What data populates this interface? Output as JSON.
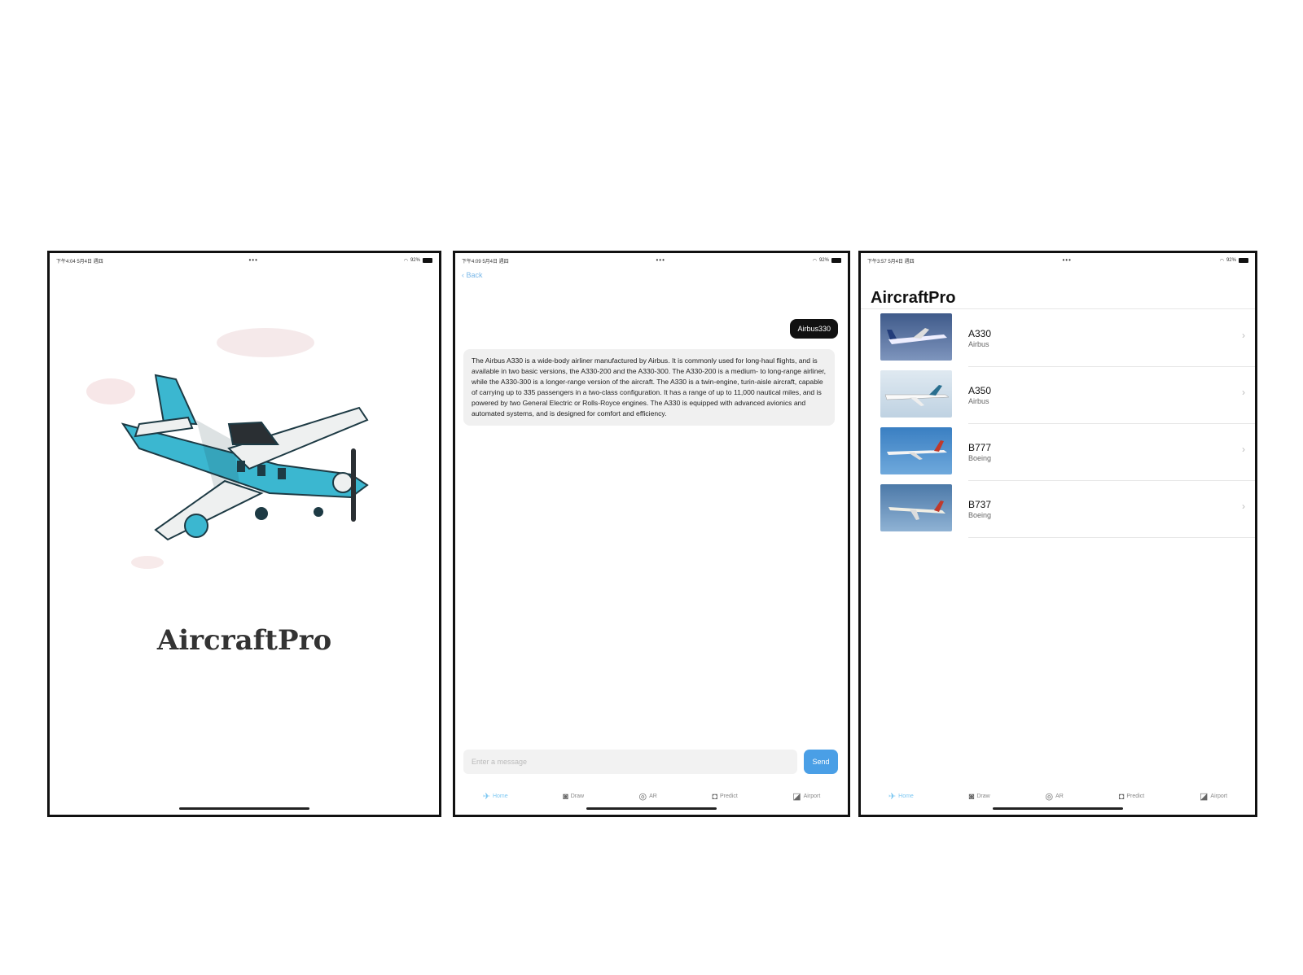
{
  "screens": {
    "splash": {
      "status": {
        "time": "下午4:04  5月4日 週四",
        "dots": "•••",
        "battery": "92%"
      },
      "app_title": "AircraftPro"
    },
    "chat": {
      "status": {
        "time": "下午4:09  5月4日 週四",
        "dots": "•••",
        "battery": "92%"
      },
      "back_label": "Back",
      "user_message": "Airbus330",
      "bot_message": "The Airbus A330 is a wide-body airliner manufactured by Airbus. It is commonly used for long-haul flights, and is available in two basic versions, the A330-200 and the A330-300. The A330-200 is a medium- to long-range airliner, while the A330-300 is a longer-range version of the aircraft. The A330 is a twin-engine, turin-aisle aircraft, capable of carrying up to 335 passengers in a two-class configuration. It has a range of up to 11,000 nautical miles, and is powered by two General Electric or Rolls-Royce engines. The A330 is equipped with advanced avionics and automated systems, and is designed for comfort and efficiency.",
      "input_placeholder": "Enter a message",
      "send_label": "Send"
    },
    "list": {
      "status": {
        "time": "下午3:57  5月4日 週四",
        "dots": "•••",
        "battery": "92%"
      },
      "title": "AircraftPro",
      "items": [
        {
          "name": "A330",
          "maker": "Airbus"
        },
        {
          "name": "A350",
          "maker": "Airbus"
        },
        {
          "name": "B777",
          "maker": "Boeing"
        },
        {
          "name": "B737",
          "maker": "Boeing"
        }
      ]
    }
  },
  "tabs": [
    {
      "label": "Home",
      "icon": "airplane-icon"
    },
    {
      "label": "Draw",
      "icon": "draw-icon"
    },
    {
      "label": "AR",
      "icon": "ar-icon"
    },
    {
      "label": "Predict",
      "icon": "camera-icon"
    },
    {
      "label": "Airport",
      "icon": "map-icon"
    }
  ],
  "colors": {
    "accent": "#4a9fe6",
    "active_tab": "#7ec8f2",
    "plane_body": "#3bb7d0"
  }
}
